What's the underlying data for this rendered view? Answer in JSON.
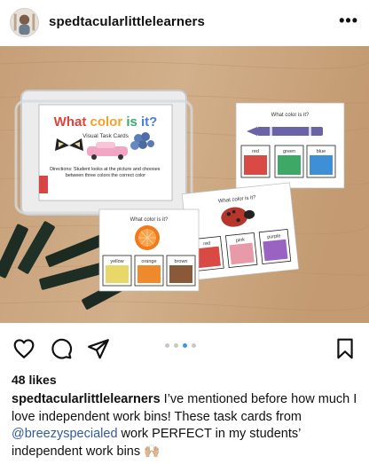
{
  "post": {
    "username": "spedtacularlittlelearners",
    "more_label": "•••",
    "likes": "48 likes",
    "caption": {
      "username": "spedtacularlittlelearners",
      "text_before": " I’ve mentioned before how much I love independent work bins! These task cards from ",
      "mention": "@breezyspecialed",
      "text_after": " work PERFECT in my students’ independent work bins ",
      "emoji": "🙌🏼"
    },
    "carousel": {
      "count": 4,
      "active_index": 2
    }
  },
  "photo": {
    "box_title": "What color is it?",
    "box_subtitle": "Visual Task Cards",
    "box_directions": "Directions: Student looks at the picture and chooses between three colors the correct color",
    "card_question": "What color is it?",
    "card_crayon": {
      "options": [
        "red",
        "green",
        "blue"
      ]
    },
    "card_orange": {
      "options": [
        "yellow",
        "orange",
        "brown"
      ]
    },
    "card_ladybug": {
      "options": [
        "red",
        "pink",
        "purple"
      ]
    }
  },
  "colors": {
    "link": "#2f5b9a",
    "carousel_active": "#3897f0",
    "table_wood": "#c9a57e"
  },
  "icons": [
    "heart-icon",
    "comment-icon",
    "share-icon",
    "bookmark-icon",
    "more-icon"
  ]
}
